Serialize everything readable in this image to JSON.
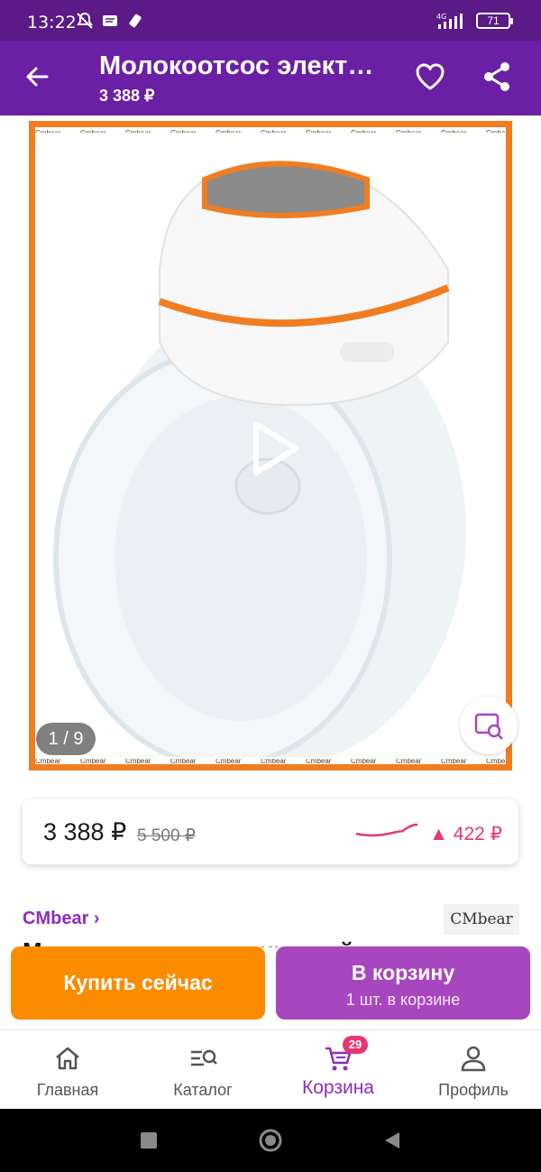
{
  "status": {
    "time": "13:22",
    "network": "4G",
    "battery": "71"
  },
  "header": {
    "title": "Молокоотсос элект…",
    "price": "3 388 ₽"
  },
  "gallery": {
    "counter": "1 / 9",
    "watermark": "Cmbear",
    "colors": {
      "frame": "#f07d22"
    }
  },
  "price_card": {
    "price": "3 388 ₽",
    "old_price": "5 500 ₽",
    "delta": "▲ 422 ₽"
  },
  "brand": {
    "link": "CMbear ›",
    "logo": "CMbear"
  },
  "product": {
    "name": "Молокоотсос электрический"
  },
  "actions": {
    "buy": "Купить сейчас",
    "cart": "В корзину",
    "cart_sub": "1 шт. в корзине"
  },
  "nav": {
    "items": [
      {
        "label": "Главная",
        "icon": "home-icon"
      },
      {
        "label": "Каталог",
        "icon": "catalog-search-icon"
      },
      {
        "label": "Корзина",
        "icon": "cart-icon"
      },
      {
        "label": "Профиль",
        "icon": "profile-icon"
      }
    ],
    "cart_badge": "29"
  },
  "colors": {
    "appbar": "#6b1fa5",
    "statusbar": "#5b1a86",
    "accent": "#8e2cc1",
    "buy": "#fb8c00",
    "cart": "#a846c0",
    "delta": "#e63772"
  }
}
